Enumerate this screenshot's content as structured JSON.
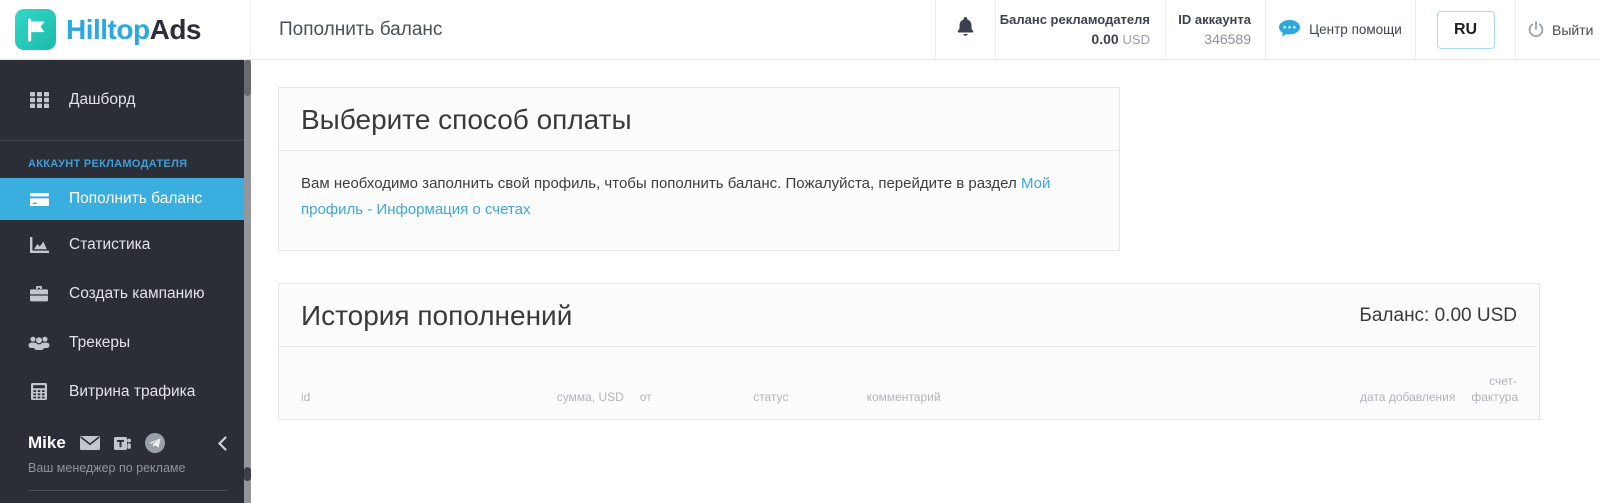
{
  "brand": {
    "name_primary": "Hilltop",
    "name_secondary": "Ads",
    "logo_icon": "flag-icon"
  },
  "header": {
    "page_title": "Пополнить баланс",
    "bell_icon": "bell-icon",
    "balance_label": "Баланс рекламодателя",
    "balance_value": "0.00",
    "balance_currency": "USD",
    "account_id_label": "ID аккаунта",
    "account_id_value": "346589",
    "help_icon": "chat-bubble-icon",
    "help_label": "Центр помощи",
    "language_button": "RU",
    "logout_icon": "power-icon",
    "logout_label": "Выйти"
  },
  "sidebar": {
    "items": [
      {
        "label": "Дашборд",
        "icon": "grid-icon",
        "active": false
      },
      {
        "label": "Пополнить баланс",
        "icon": "credit-card-icon",
        "active": true
      },
      {
        "label": "Статистика",
        "icon": "area-chart-icon",
        "active": false
      },
      {
        "label": "Создать кампанию",
        "icon": "briefcase-icon",
        "active": false
      },
      {
        "label": "Трекеры",
        "icon": "users-icon",
        "active": false
      },
      {
        "label": "Витрина трафика",
        "icon": "calculator-icon",
        "active": false
      }
    ],
    "section_label": "АККАУНТ РЕКЛАМОДАТЕЛЯ",
    "manager": {
      "name": "Mike",
      "subtitle": "Ваш менеджер по рекламе",
      "contact_icons": [
        "envelope-icon",
        "teams-icon",
        "telegram-icon"
      ],
      "collapse_icon": "chevron-left-icon"
    }
  },
  "payment_panel": {
    "title": "Выберите способ оплаты",
    "notice_text": "Вам необходимо заполнить свой профиль, чтобы пополнить баланс. Пожалуйста, перейдите в раздел ",
    "notice_link": "Мой профиль - Информация о счетах"
  },
  "history_panel": {
    "title": "История пополнений",
    "balance_text": "Баланс: 0.00 USD",
    "columns": [
      "id",
      "сумма, USD",
      "от",
      "статус",
      "комментарий",
      "дата добавления",
      "счет-фактура"
    ],
    "rows": []
  },
  "colors": {
    "accent_blue": "#3aaede",
    "brand_blue": "#29a9e0",
    "brand_teal": "#22c9b7",
    "link_blue": "#3aa7dd",
    "sidebar_bg": "#2b2e37",
    "section_label_blue": "#3f9ed6"
  }
}
